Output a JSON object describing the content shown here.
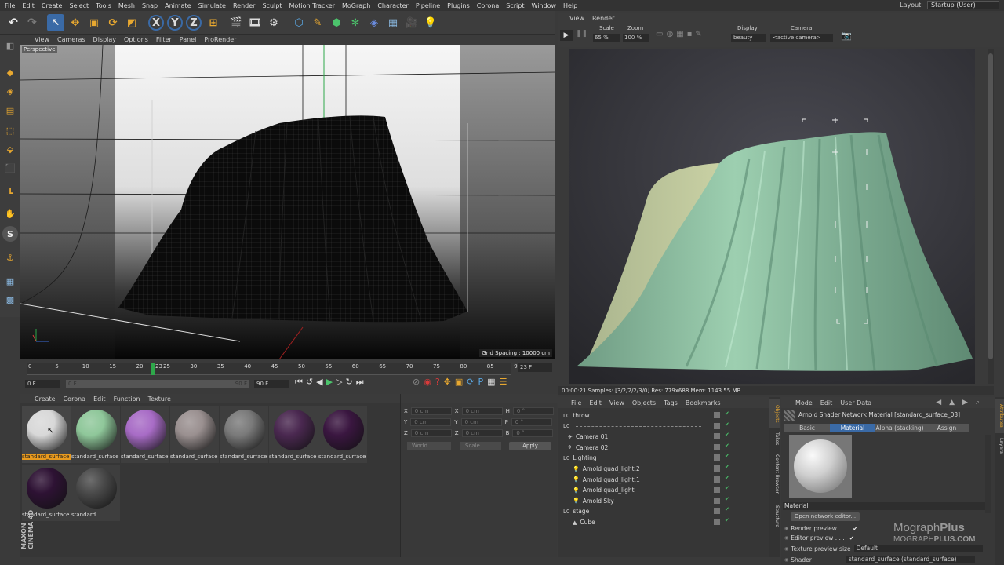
{
  "menubar": {
    "items": [
      "File",
      "Edit",
      "Create",
      "Select",
      "Tools",
      "Mesh",
      "Snap",
      "Animate",
      "Simulate",
      "Render",
      "Sculpt",
      "Motion Tracker",
      "MoGraph",
      "Character",
      "Pipeline",
      "Plugins",
      "Corona",
      "Script",
      "Window",
      "Help"
    ],
    "layout_label": "Layout:",
    "layout_value": "Startup (User)"
  },
  "toolbar": {
    "axis_x": "X",
    "axis_y": "Y",
    "axis_z": "Z"
  },
  "viewport": {
    "menu": [
      "View",
      "Cameras",
      "Display",
      "Options",
      "Filter",
      "Panel",
      "ProRender"
    ],
    "label": "Perspective",
    "grid_spacing": "Grid Spacing : 10000 cm"
  },
  "timeline": {
    "ticks": [
      "0",
      "5",
      "10",
      "15",
      "20",
      "25",
      "30",
      "35",
      "40",
      "45",
      "50",
      "55",
      "60",
      "65",
      "70",
      "75",
      "80",
      "85",
      "90"
    ],
    "current_frame": "23",
    "frame_field": "23 F",
    "start_field": "0 F",
    "range_start": "0 F",
    "range_end": "90 F",
    "end_field": "90 F"
  },
  "materials": {
    "menu": [
      "Create",
      "Corona",
      "Edit",
      "Function",
      "Texture"
    ],
    "items": [
      {
        "label": "standard_surface",
        "color": "#d8d8d8",
        "selected": true
      },
      {
        "label": "standard_surface",
        "color": "#8fc79a"
      },
      {
        "label": "standard_surface",
        "color": "#a86cc6"
      },
      {
        "label": "standard_surface",
        "color": "#9a9090"
      },
      {
        "label": "standard_surface",
        "color": "#7a7a7a"
      },
      {
        "label": "standard_surface",
        "color": "#4a2850"
      },
      {
        "label": "standard_surface",
        "color": "#3a1640"
      },
      {
        "label": "standard_surface",
        "color": "#2e1234"
      },
      {
        "label": "standard",
        "color": "#4a4a4a"
      }
    ]
  },
  "coords": {
    "rows": [
      {
        "a": "X",
        "av": "0 cm",
        "b": "X",
        "bv": "0 cm",
        "c": "H",
        "cv": "0 °"
      },
      {
        "a": "Y",
        "av": "0 cm",
        "b": "Y",
        "bv": "0 cm",
        "c": "P",
        "cv": "0 °"
      },
      {
        "a": "Z",
        "av": "0 cm",
        "b": "Z",
        "bv": "0 cm",
        "c": "B",
        "cv": "0 °"
      }
    ],
    "world": "World",
    "scale": "Scale",
    "apply": "Apply"
  },
  "render_view": {
    "menu": [
      "View",
      "Render"
    ],
    "scale_label": "Scale",
    "scale_value": "65 %",
    "zoom_label": "Zoom",
    "zoom_value": "100 %",
    "display_label": "Display",
    "display_value": "beauty",
    "camera_label": "Camera",
    "camera_value": "<active camera>",
    "status": "00:00:21  Samples: [3/2/2/2/3/0]  Res: 779x688  Mem: 1143.55 MB"
  },
  "objects": {
    "menu": [
      "File",
      "Edit",
      "View",
      "Objects",
      "Tags",
      "Bookmarks"
    ],
    "rows": [
      {
        "name": "throw",
        "indent": 0
      },
      {
        "name": "",
        "indent": 0
      },
      {
        "name": "Camera 01",
        "indent": 1
      },
      {
        "name": "Camera 02",
        "indent": 1
      },
      {
        "name": "Lighting",
        "indent": 0
      },
      {
        "name": "Arnold quad_light.2",
        "indent": 2
      },
      {
        "name": "Arnold quad_light.1",
        "indent": 2
      },
      {
        "name": "Arnold quad_light",
        "indent": 2
      },
      {
        "name": "Arnold Sky",
        "indent": 2
      },
      {
        "name": "stage",
        "indent": 0
      },
      {
        "name": "Cube",
        "indent": 2
      }
    ],
    "side_tabs": [
      "Objects",
      "Takes",
      "Content Browser",
      "Structure"
    ]
  },
  "attributes": {
    "menu": [
      "Mode",
      "Edit",
      "User Data"
    ],
    "title": "Arnold Shader Network Material [standard_surface_03]",
    "tabs": [
      "Basic",
      "Material",
      "Alpha (stacking)",
      "Assign"
    ],
    "active_tab": "Material",
    "section": "Material",
    "open_editor": "Open network editor...",
    "render_preview": "Render preview . . .",
    "editor_preview": "Editor preview . . .",
    "texture_preview_label": "Texture preview size",
    "texture_preview_value": "Default",
    "shader_label": "Shader",
    "shader_value": "standard_surface (standard_surface)",
    "side_tabs": [
      "Attributes",
      "Layers"
    ]
  },
  "watermark": {
    "brand1": "Mograph",
    "brand2": "Plus",
    "url1": "MOGRAPH",
    "url2": "PLUS.COM"
  },
  "maxon": {
    "line1": "MAXON",
    "line2": "CINEMA 4D"
  },
  "colors": {
    "accent_blue": "#3a6aa6",
    "selection_orange": "#e89a1e",
    "cloth_green": "#8fc9a6"
  }
}
